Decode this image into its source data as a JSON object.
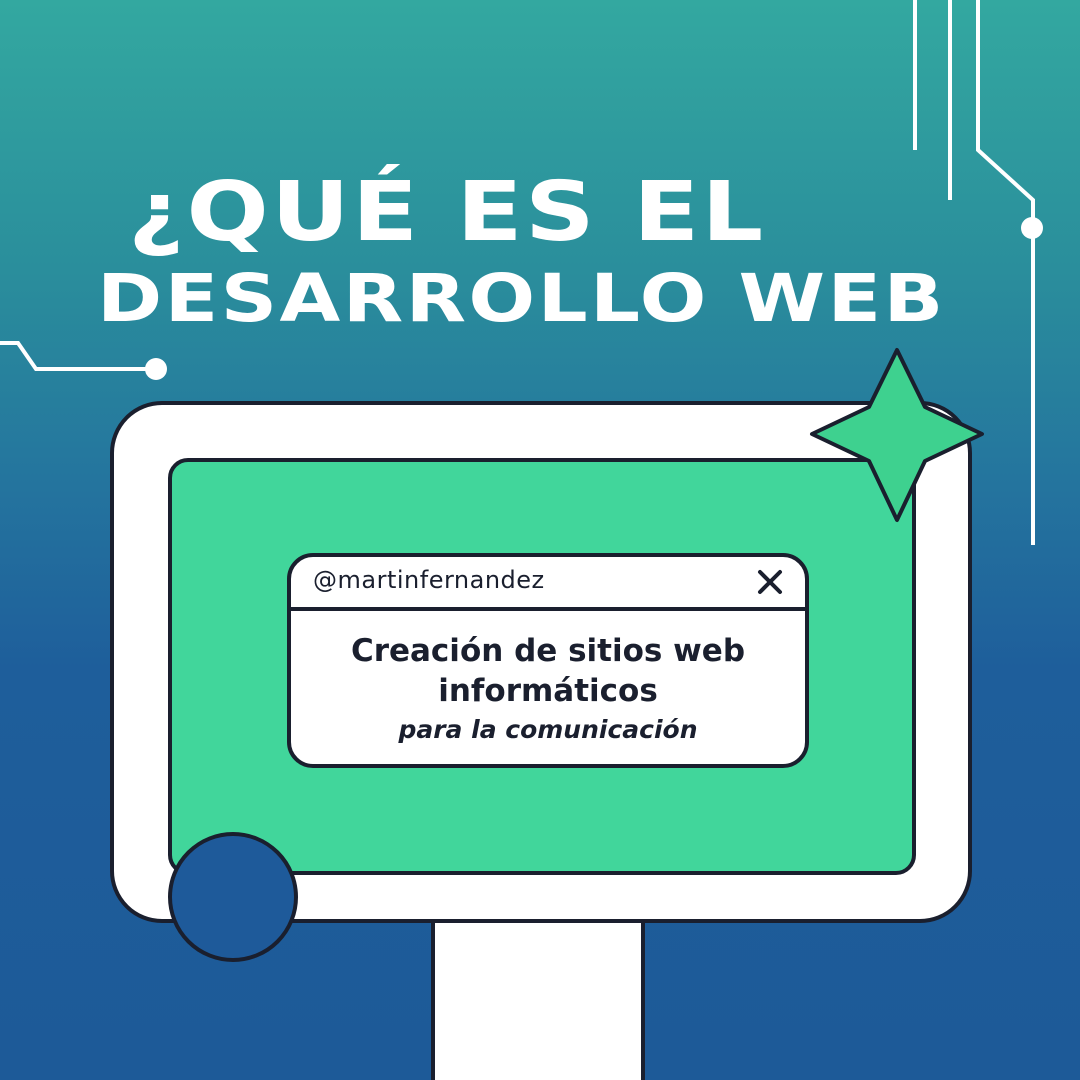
{
  "title": {
    "line1": "¿QUÉ ES EL",
    "line2": "DESARROLLO WEB"
  },
  "popup": {
    "handle": "@martinfernandez",
    "heading_line1": "Creación de sitios web",
    "heading_line2": "informáticos",
    "subheading": "para la comunicación",
    "close_icon": "close-icon"
  },
  "colors": {
    "background_top": "#33a8a0",
    "background_bottom": "#1d5a98",
    "screen_green": "#41d69b",
    "outline": "#1a1f2e",
    "circle_blue": "#1e5a9a",
    "star_green": "#3ed18f",
    "white": "#ffffff"
  }
}
